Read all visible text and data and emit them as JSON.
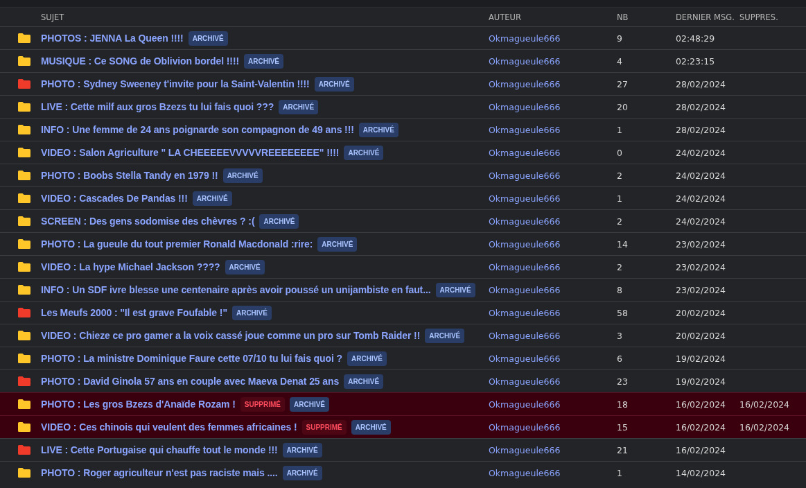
{
  "columns": [
    "SUJET",
    "AUTEUR",
    "NB",
    "DERNIER MSG.",
    "SUPPRES."
  ],
  "rows": [
    {
      "color": "#ffc629",
      "title": "PHOTOS : JENNA La Queen !!!!",
      "deleted": false,
      "badge": "ARCHIVÉ",
      "author": "Okmagueule666",
      "count": "9",
      "last": "02:48:29"
    },
    {
      "color": "#ffc629",
      "title": "MUSIQUE : Ce SONG de Oblivion bordel !!!!",
      "deleted": false,
      "badge": "ARCHIVÉ",
      "author": "Okmagueule666",
      "count": "4",
      "last": "02:23:15"
    },
    {
      "color": "#f03a2a",
      "title": "PHOTO : Sydney Sweeney t'invite pour la Saint-Valentin !!!!",
      "deleted": false,
      "badge": "ARCHIVÉ",
      "author": "Okmagueule666",
      "count": "27",
      "last": "28/02/2024"
    },
    {
      "color": "#ffc629",
      "title": "LIVE : Cette milf aux gros Bzezs tu lui fais quoi ???",
      "deleted": false,
      "badge": "ARCHIVÉ",
      "author": "Okmagueule666",
      "count": "20",
      "last": "28/02/2024"
    },
    {
      "color": "#ffc629",
      "title": "INFO : Une femme de 24 ans poignarde son compagnon de 49 ans !!!",
      "deleted": false,
      "badge": "ARCHIVÉ",
      "author": "Okmagueule666",
      "count": "1",
      "last": "28/02/2024"
    },
    {
      "color": "#ffc629",
      "title": "VIDEO : Salon Agriculture \" LA CHEEEEEVVVVVREEEEEEEE\" !!!!",
      "deleted": false,
      "badge": "ARCHIVÉ",
      "author": "Okmagueule666",
      "count": "0",
      "last": "24/02/2024"
    },
    {
      "color": "#ffc629",
      "title": "PHOTO : Boobs Stella Tandy en 1979 !!",
      "deleted": false,
      "badge": "ARCHIVÉ",
      "author": "Okmagueule666",
      "count": "2",
      "last": "24/02/2024"
    },
    {
      "color": "#ffc629",
      "title": "VIDEO : Cascades De Pandas !!!",
      "deleted": false,
      "badge": "ARCHIVÉ",
      "author": "Okmagueule666",
      "count": "1",
      "last": "24/02/2024"
    },
    {
      "color": "#ffc629",
      "title": "SCREEN : Des gens sodomise des chèvres ? :(",
      "deleted": false,
      "badge": "ARCHIVÉ",
      "author": "Okmagueule666",
      "count": "2",
      "last": "24/02/2024"
    },
    {
      "color": "#ffc629",
      "title": "PHOTO : La gueule du tout premier Ronald Macdonald :rire:",
      "deleted": false,
      "badge": "ARCHIVÉ",
      "author": "Okmagueule666",
      "count": "14",
      "last": "23/02/2024"
    },
    {
      "color": "#ffc629",
      "title": "VIDEO : La hype Michael Jackson ????",
      "deleted": false,
      "badge": "ARCHIVÉ",
      "author": "Okmagueule666",
      "count": "2",
      "last": "23/02/2024"
    },
    {
      "color": "#ffc629",
      "title": "INFO : Un SDF ivre blesse une centenaire après avoir poussé un unijambiste en faut...",
      "deleted": false,
      "badge": "ARCHIVÉ",
      "author": "Okmagueule666",
      "count": "8",
      "last": "23/02/2024"
    },
    {
      "color": "#f03a2a",
      "title": "Les Meufs 2000 : \"Il est grave Foufable !\"",
      "deleted": false,
      "badge": "ARCHIVÉ",
      "author": "Okmagueule666",
      "count": "58",
      "last": "20/02/2024"
    },
    {
      "color": "#ffc629",
      "title": "VIDEO : Chieze ce pro gamer a la voix cassé joue comme un pro sur Tomb Raider !!",
      "deleted": false,
      "badge": "ARCHIVÉ",
      "author": "Okmagueule666",
      "count": "3",
      "last": "20/02/2024"
    },
    {
      "color": "#ffc629",
      "title": "PHOTO : La ministre Dominique Faure cette 07/10 tu lui fais quoi ?",
      "deleted": false,
      "badge": "ARCHIVÉ",
      "author": "Okmagueule666",
      "count": "6",
      "last": "19/02/2024"
    },
    {
      "color": "#f03a2a",
      "title": "PHOTO : David Ginola 57 ans en couple avec Maeva Denat 25 ans",
      "deleted": false,
      "badge": "ARCHIVÉ",
      "author": "Okmagueule666",
      "count": "23",
      "last": "19/02/2024"
    },
    {
      "color": "#ffc629",
      "title": "PHOTO : Les gros Bzezs d'Anaïde Rozam !",
      "deleted": true,
      "deleted_badge": "SUPPRIMÉ",
      "badge": "ARCHIVÉ",
      "author": "Okmagueule666",
      "count": "18",
      "last": "16/02/2024",
      "deleted_on": "16/02/2024"
    },
    {
      "color": "#ffc629",
      "title": "VIDEO : Ces chinois qui veulent des femmes africaines !",
      "deleted": true,
      "deleted_badge": "SUPPRIMÉ",
      "badge": "ARCHIVÉ",
      "author": "Okmagueule666",
      "count": "15",
      "last": "16/02/2024",
      "deleted_on": "16/02/2024"
    },
    {
      "color": "#f03a2a",
      "title": "LIVE : Cette Portugaise qui chauffe tout le monde !!!",
      "deleted": false,
      "badge": "ARCHIVÉ",
      "author": "Okmagueule666",
      "count": "21",
      "last": "16/02/2024"
    },
    {
      "color": "#ffc629",
      "title": "PHOTO : Roger agriculteur n'est pas raciste mais ....",
      "deleted": false,
      "badge": "ARCHIVÉ",
      "author": "Okmagueule666",
      "count": "1",
      "last": "14/02/2024"
    }
  ]
}
